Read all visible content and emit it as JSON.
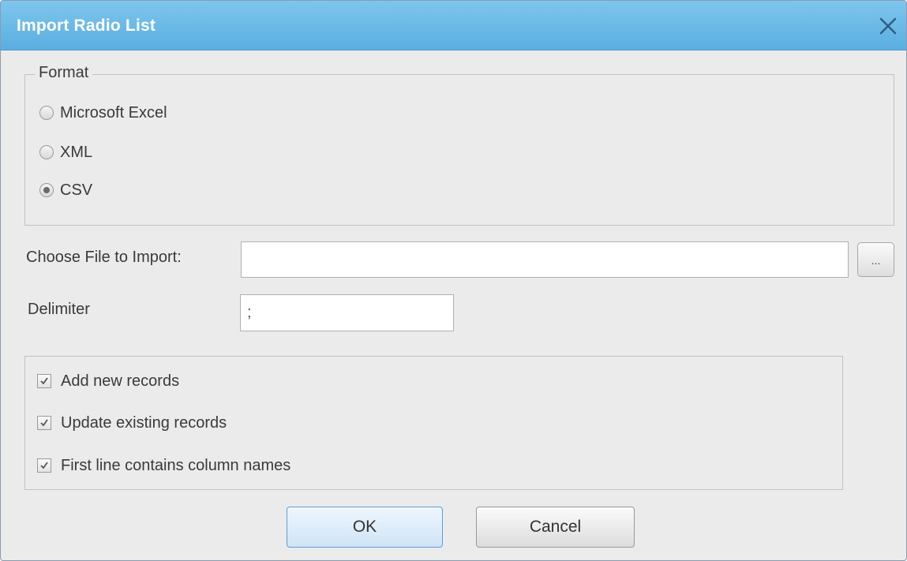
{
  "window": {
    "title": "Import Radio List",
    "close_icon": "close-icon"
  },
  "format": {
    "legend": "Format",
    "options": [
      {
        "label": "Microsoft Excel",
        "selected": false
      },
      {
        "label": "XML",
        "selected": false
      },
      {
        "label": "CSV",
        "selected": true
      }
    ]
  },
  "file": {
    "label": "Choose File to Import:",
    "value": "",
    "browse_label": "..."
  },
  "delimiter": {
    "label": "Delimiter",
    "value": ";"
  },
  "options": [
    {
      "label": "Add new records",
      "checked": true
    },
    {
      "label": "Update existing records",
      "checked": true
    },
    {
      "label": "First line contains column names",
      "checked": true
    }
  ],
  "buttons": {
    "ok_label": "OK",
    "cancel_label": "Cancel"
  },
  "colors": {
    "titlebar": "#5aaee0",
    "dialog_bg": "#ebebeb",
    "ok_border": "#5d9fd6"
  }
}
